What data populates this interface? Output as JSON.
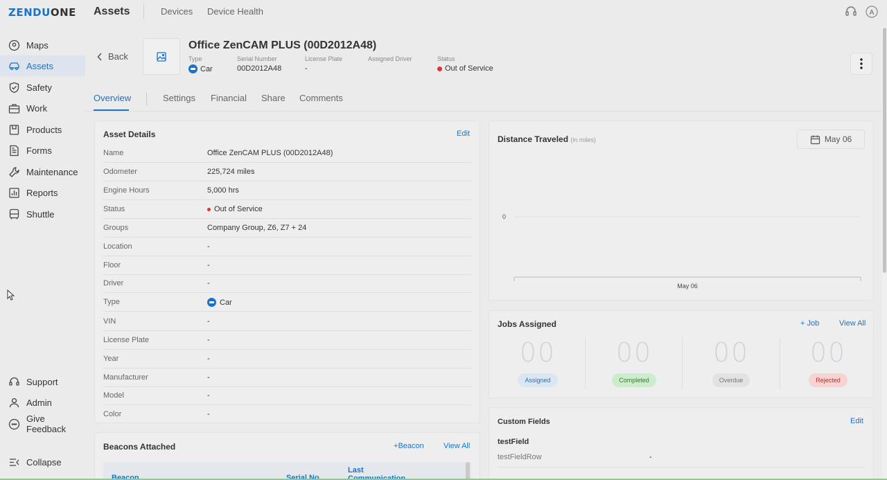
{
  "app": {
    "logo_left": "ZENDU",
    "logo_right": "ONE",
    "section_title": "Assets",
    "top_tabs": [
      "Devices",
      "Device Health"
    ]
  },
  "sidebar": {
    "items": [
      {
        "label": "Maps",
        "icon": "map-pin-icon"
      },
      {
        "label": "Assets",
        "icon": "car-icon"
      },
      {
        "label": "Safety",
        "icon": "shield-icon"
      },
      {
        "label": "Work",
        "icon": "briefcase-icon"
      },
      {
        "label": "Products",
        "icon": "box-icon"
      },
      {
        "label": "Forms",
        "icon": "document-icon"
      },
      {
        "label": "Maintenance",
        "icon": "wrench-icon"
      },
      {
        "label": "Reports",
        "icon": "chart-icon"
      },
      {
        "label": "Shuttle",
        "icon": "bus-icon"
      }
    ],
    "bottom_items": [
      {
        "label": "Support",
        "icon": "headset-icon"
      },
      {
        "label": "Admin",
        "icon": "user-icon"
      },
      {
        "label": "Give Feedback",
        "icon": "feedback-icon"
      },
      {
        "label": "Collapse",
        "icon": "collapse-icon"
      }
    ]
  },
  "header": {
    "back_label": "Back",
    "title": "Office ZenCAM PLUS (00D2012A48)",
    "meta": [
      {
        "label": "Type",
        "value": "Car"
      },
      {
        "label": "Serial Number",
        "value": "00D2012A48"
      },
      {
        "label": "License Plate",
        "value": "-"
      },
      {
        "label": "Assigned Driver",
        "value": ""
      },
      {
        "label": "Status",
        "value": "Out of Service"
      }
    ]
  },
  "tabs": [
    "Overview",
    "Settings",
    "Financial",
    "Share",
    "Comments"
  ],
  "asset_details": {
    "title": "Asset Details",
    "edit_label": "Edit",
    "rows": [
      {
        "key": "Name",
        "value": "Office ZenCAM PLUS (00D2012A48)"
      },
      {
        "key": "Odometer",
        "value": "225,724 miles"
      },
      {
        "key": "Engine Hours",
        "value": "5,000 hrs"
      },
      {
        "key": "Status",
        "value": "Out of Service"
      },
      {
        "key": "Groups",
        "value": "Company Group, Z6, Z7 + 24"
      },
      {
        "key": "Location",
        "value": "-"
      },
      {
        "key": "Floor",
        "value": "-"
      },
      {
        "key": "Driver",
        "value": "-"
      },
      {
        "key": "Type",
        "value": "Car"
      },
      {
        "key": "VIN",
        "value": "-"
      },
      {
        "key": "License Plate",
        "value": "-"
      },
      {
        "key": "Year",
        "value": "-"
      },
      {
        "key": "Manufacturer",
        "value": "-"
      },
      {
        "key": "Model",
        "value": "-"
      },
      {
        "key": "Color",
        "value": "-"
      }
    ]
  },
  "beacons": {
    "title": "Beacons Attached",
    "add_label": "Beacon",
    "view_all_label": "View All",
    "columns": [
      "Beacon",
      "Serial No.",
      "Last Communication"
    ]
  },
  "distance": {
    "title": "Distance Traveled",
    "unit_note": "(in miles)",
    "date_label": "May 06"
  },
  "chart_data": {
    "type": "line",
    "title": "Distance Traveled",
    "categories": [
      "May 06"
    ],
    "y_tick_labels": [
      "0"
    ],
    "series": [
      {
        "values": [
          0
        ]
      }
    ],
    "ylim": [
      0,
      0
    ],
    "grid": true
  },
  "jobs": {
    "title": "Jobs Assigned",
    "add_label": "Job",
    "view_all_label": "View All",
    "stats": [
      {
        "count": "00",
        "label": "Assigned",
        "bg": "#dbe6f3",
        "fg": "#1a73c8"
      },
      {
        "count": "00",
        "label": "Completed",
        "bg": "#cdeccc",
        "fg": "#2e7d32"
      },
      {
        "count": "00",
        "label": "Overdue",
        "bg": "#e2e2e2",
        "fg": "#777777"
      },
      {
        "count": "00",
        "label": "Rejected",
        "bg": "#f7d3d1",
        "fg": "#c62828"
      }
    ]
  },
  "custom_fields": {
    "title": "Custom Fields",
    "edit_label": "Edit",
    "field_name": "testField",
    "row_key": "testFieldRow",
    "row_value": "-"
  }
}
